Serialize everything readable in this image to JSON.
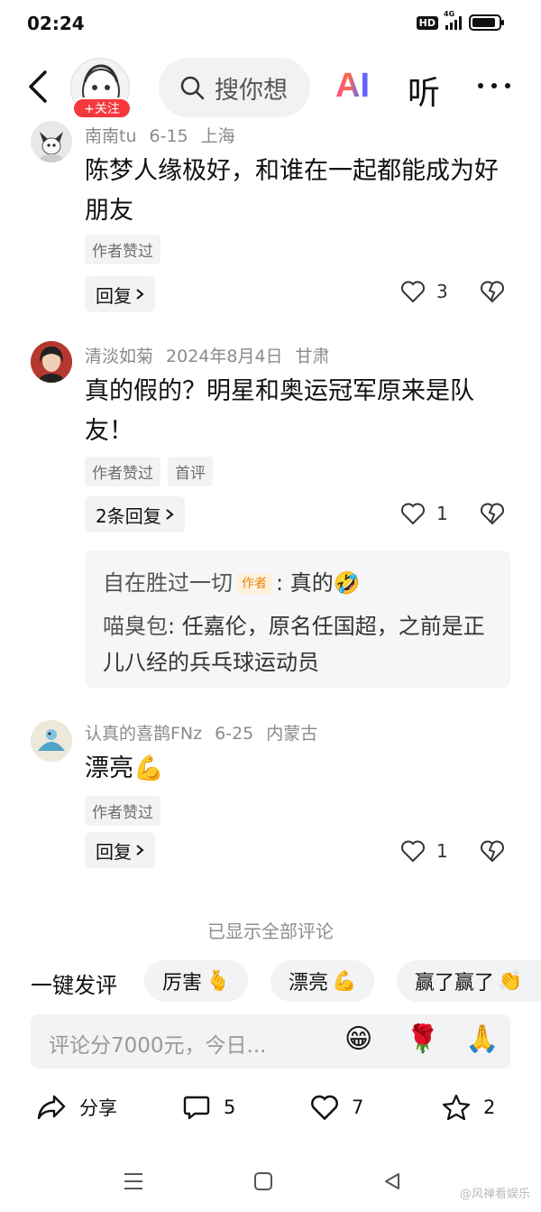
{
  "status_bar": {
    "time": "02:24",
    "hd": "HD",
    "network": "4G",
    "battery_level": 0.9
  },
  "header": {
    "follow_label": "+关注",
    "search_placeholder": "搜你想",
    "ai_label": "AI",
    "listen_label": "听"
  },
  "comments": [
    {
      "user": "南南tu",
      "date": "6-15",
      "location": "上海",
      "text": "陈梦人缘极好，和谁在一起都能成为好朋友",
      "tags": [
        "作者赞过"
      ],
      "reply_label": "回复",
      "likes": "3"
    },
    {
      "user": "清淡如菊",
      "date": "2024年8月4日",
      "location": "甘肃",
      "text": "真的假的？明星和奥运冠军原来是队友！",
      "tags": [
        "作者赞过",
        "首评"
      ],
      "reply_label": "2条回复",
      "likes": "1",
      "sub_replies": [
        {
          "name": "自在胜过一切",
          "badge": "作者",
          "text": "真的",
          "emoji": "🤣"
        },
        {
          "name": "喵臭包",
          "text": "任嘉伦，原名任国超，之前是正儿八经的兵乓球运动员"
        }
      ]
    },
    {
      "user": "认真的喜鹊FNz",
      "date": "6-25",
      "location": "内蒙古",
      "text": "漂亮",
      "emoji": "💪",
      "tags": [
        "作者赞过"
      ],
      "reply_label": "回复",
      "likes": "1"
    }
  ],
  "all_shown_label": "已显示全部评论",
  "quick_comment": {
    "label": "一键发评",
    "chips": [
      {
        "text": "厉害",
        "emoji": "🫰"
      },
      {
        "text": "漂亮",
        "emoji": "💪"
      },
      {
        "text": "赢了赢了",
        "emoji": "👏"
      }
    ]
  },
  "input": {
    "placeholder": "评论分7000元，今日...",
    "emojis": [
      "😁",
      "🌹",
      "🙏"
    ]
  },
  "bottom_bar": {
    "share_label": "分享",
    "comment_count": "5",
    "like_count": "7",
    "favorite_count": "2"
  },
  "watermark": "@风禅看娱乐"
}
